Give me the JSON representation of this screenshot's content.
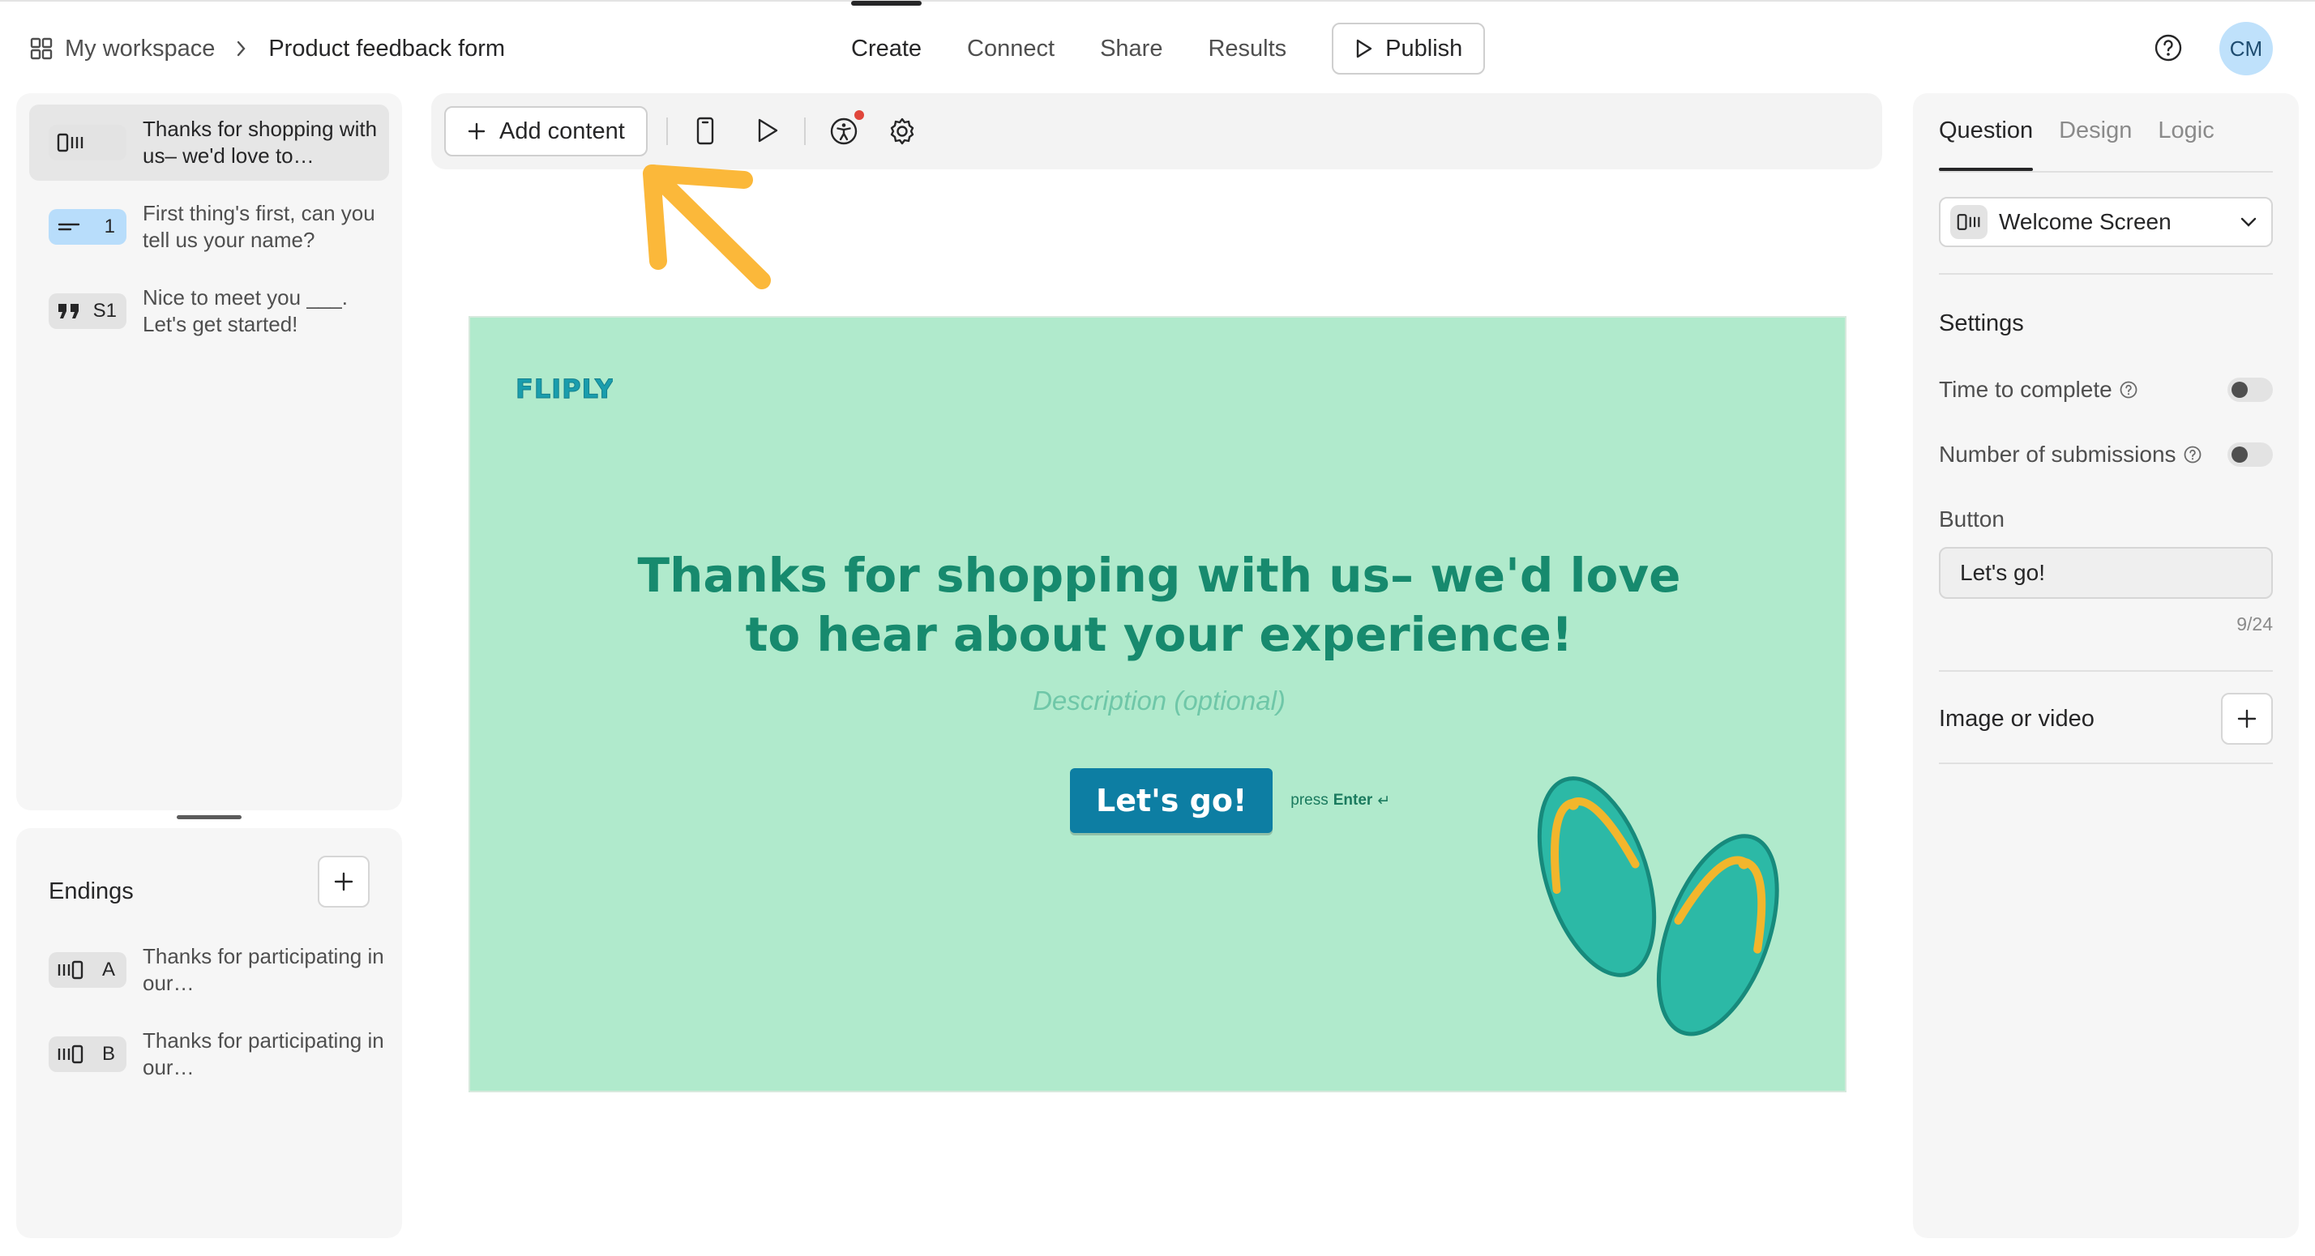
{
  "breadcrumb": {
    "workspace": "My workspace",
    "form": "Product feedback form"
  },
  "nav": {
    "tabs": [
      "Create",
      "Connect",
      "Share",
      "Results"
    ],
    "active": "Create",
    "publish": "Publish"
  },
  "user": {
    "initials": "CM"
  },
  "sidebar": {
    "questions": [
      {
        "icon": "welcome-screen-icon",
        "badge": "",
        "text": "Thanks for shopping with us– we'd love to…",
        "selected": true
      },
      {
        "icon": "short-text-icon",
        "badge": "1",
        "text": "First thing's first, can you tell us your name?",
        "selected": false
      },
      {
        "icon": "statement-quote-icon",
        "badge": "S1",
        "text": "Nice to meet you ___. Let's get started!",
        "selected": false
      }
    ],
    "endings": {
      "title": "Endings",
      "items": [
        {
          "icon": "end-screen-icon",
          "badge": "A",
          "text": "Thanks for participating in our…"
        },
        {
          "icon": "end-screen-icon",
          "badge": "B",
          "text": "Thanks for participating in our…"
        }
      ]
    }
  },
  "toolbar": {
    "add_content": "Add content"
  },
  "preview": {
    "logo": "FLIPLY",
    "title": "Thanks for shopping with us– we'd love to hear about your experience!",
    "description_placeholder": "Description (optional)",
    "button": "Let's go!",
    "press_prefix": "press",
    "press_key": "Enter",
    "press_symbol": "↵",
    "background_color": "#b0eacc",
    "accent_color": "#178a6e",
    "button_color": "#0d7ea3"
  },
  "panel": {
    "tabs": [
      "Question",
      "Design",
      "Logic"
    ],
    "active_tab": "Question",
    "type": "Welcome Screen",
    "settings_title": "Settings",
    "settings": [
      {
        "label": "Time to complete",
        "enabled": false
      },
      {
        "label": "Number of submissions",
        "enabled": false
      }
    ],
    "button_label": "Button",
    "button_value": "Let's go!",
    "char_count": "9/24",
    "media_label": "Image or video"
  }
}
